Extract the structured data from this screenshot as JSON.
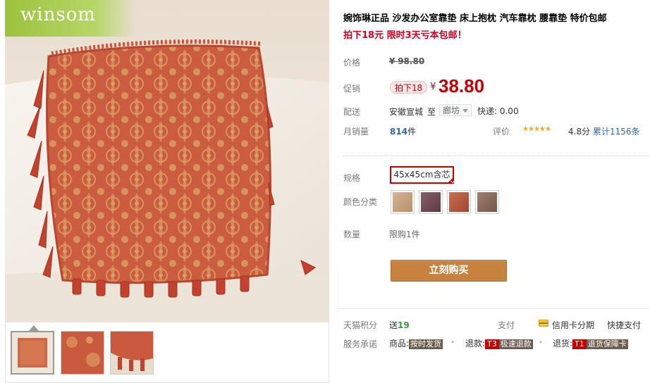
{
  "brand": {
    "logo_text": "winsom"
  },
  "product": {
    "title": "婉饰琳正品 沙发办公室靠垫 床上抱枕 汽车靠枕 腰靠垫 特价包邮",
    "subtitle": "拍下18元 限时3天亏本包邮！"
  },
  "price": {
    "label": "价格",
    "currency": "¥",
    "original": "98.80"
  },
  "promo": {
    "label": "促销",
    "badge": "拍下18",
    "currency": "¥",
    "price": "38.80"
  },
  "shipping": {
    "label": "配送",
    "from": "安徽宣城",
    "to_word": "至",
    "destination": "廊坊",
    "express": "快递: 0.00"
  },
  "sales": {
    "label": "月销量",
    "count": "814",
    "unit": "件",
    "rating_label": "评价",
    "stars": "★★★★★",
    "score": "4.8分",
    "reviews": "累计1156条"
  },
  "spec": {
    "label": "规格",
    "selected": "45x45cm含芯"
  },
  "color": {
    "label": "颜色分类",
    "swatches": [
      "#c9a27c",
      "#6f4a52",
      "#b35a3c",
      "#8b6a58"
    ]
  },
  "quantity": {
    "label": "数量",
    "limit": "限购1件"
  },
  "buy_button": "立刻购买",
  "points": {
    "label": "天猫积分",
    "text": "送",
    "value": "19"
  },
  "payment": {
    "label": "支付",
    "credit": "信用卡分期",
    "quick": "快捷支付"
  },
  "service": {
    "label": "服务承诺",
    "goods_prefix": "商品:",
    "goods_tag": "按时发货",
    "refund_prefix": "退款:",
    "refund_code": "T3",
    "refund_tag": "极速退款",
    "return_prefix": "退货:",
    "return_code": "T1",
    "return_tag": "退货保障卡"
  },
  "colors": {
    "accent_red": "#c40000",
    "buy_button": "#c8823f",
    "brand_green": "#9cc33b"
  }
}
